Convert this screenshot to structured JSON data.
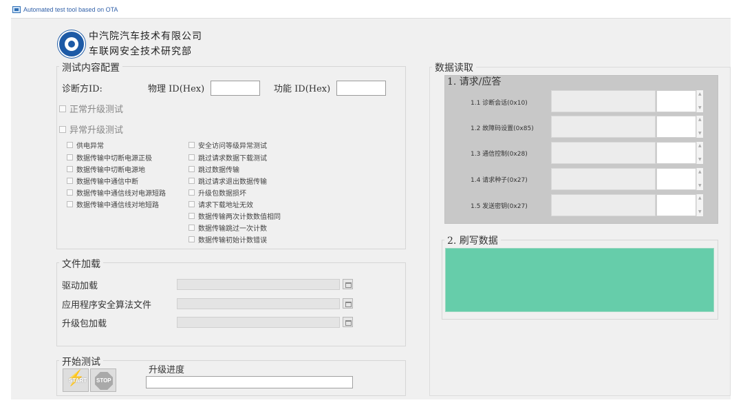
{
  "window": {
    "title": "Automated test tool based on OTA"
  },
  "header": {
    "company": "中汽院汽车技术有限公司",
    "department": "车联网安全技术研究部"
  },
  "test_config": {
    "title": "测试内容配置",
    "diag_label": "诊断方ID:",
    "physical_label": "物理  ID(Hex)",
    "physical_value": "",
    "functional_label": "功能  ID(Hex)",
    "functional_value": "",
    "normal_upgrade": "正常升级测试",
    "abnormal_upgrade": "异常升级测试",
    "left_options": [
      "供电异常",
      "数据传输中切断电源正极",
      "数据传输中切断电源地",
      "数据传输中通信中断",
      "数据传输中通信线对电源短路",
      "数据传输中通信线对地短路"
    ],
    "right_options": [
      "安全访问等级异常测试",
      "跳过请求数据下载测试",
      "跳过数据传输",
      "跳过请求退出数据传输",
      "升级包数据损坏",
      "请求下载地址无效",
      "数据传输两次计数数值相同",
      "数据传输跳过一次计数",
      "数据传输初始计数错误"
    ]
  },
  "file_load": {
    "title": "文件加载",
    "items": [
      {
        "label": "驱动加载",
        "value": ""
      },
      {
        "label": "应用程序安全算法文件",
        "value": ""
      },
      {
        "label": "升级包加载",
        "value": ""
      }
    ]
  },
  "start_test": {
    "title": "开始测试",
    "start_label": "START",
    "stop_label": "STOP",
    "progress_label": "升级进度",
    "progress_value": 0
  },
  "data_read": {
    "title": "数据读取",
    "req_resp_title": "1. 请求/应答",
    "rows": [
      {
        "label": "1.1 诊断会话(0x10)",
        "value": "",
        "response": ""
      },
      {
        "label": "1.2 故障码设置(0x85)",
        "value": "",
        "response": ""
      },
      {
        "label": "1.3 通信控制(0x28)",
        "value": "",
        "response": ""
      },
      {
        "label": "1.4 请求种子(0x27)",
        "value": "",
        "response": ""
      },
      {
        "label": "1.5 发送密钥(0x27)",
        "value": "",
        "response": ""
      }
    ],
    "flash_title": "2.  刷写数据",
    "flash_color": "#66cdaa"
  }
}
